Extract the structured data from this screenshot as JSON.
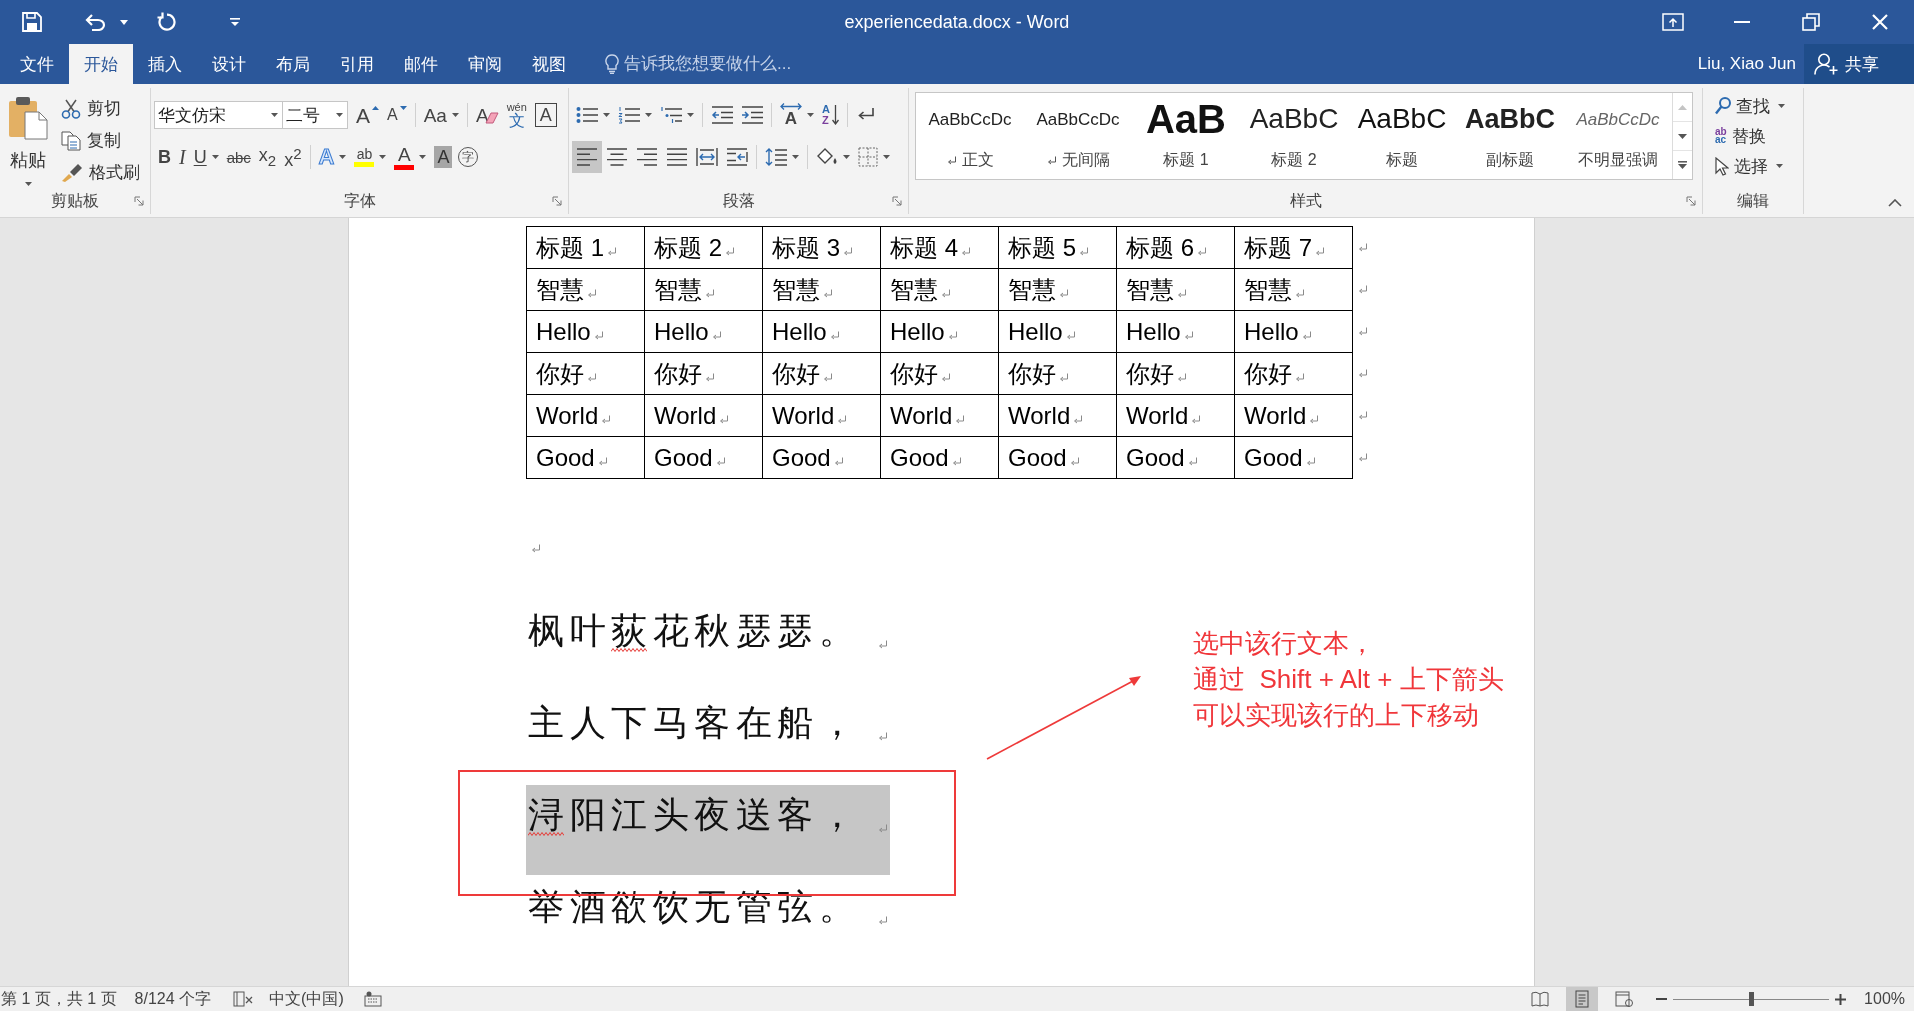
{
  "window": {
    "title": "experiencedata.docx - Word"
  },
  "tabs": [
    {
      "label": "文件",
      "selected": false
    },
    {
      "label": "开始",
      "selected": true
    },
    {
      "label": "插入",
      "selected": false
    },
    {
      "label": "设计",
      "selected": false
    },
    {
      "label": "布局",
      "selected": false
    },
    {
      "label": "引用",
      "selected": false
    },
    {
      "label": "邮件",
      "selected": false
    },
    {
      "label": "审阅",
      "selected": false
    },
    {
      "label": "视图",
      "selected": false
    }
  ],
  "tell_me": {
    "placeholder": "告诉我您想要做什么..."
  },
  "account": {
    "user": "Liu, Xiao Jun",
    "share_label": "共享"
  },
  "ribbon": {
    "clipboard": {
      "label": "剪贴板",
      "paste_label": "粘贴",
      "actions": [
        {
          "kind": "cut",
          "label": "剪切"
        },
        {
          "kind": "copy",
          "label": "复制"
        },
        {
          "kind": "format_painter",
          "label": "格式刷"
        }
      ]
    },
    "font": {
      "label": "字体",
      "font_name": "华文仿宋",
      "font_size": "二号",
      "row_1": [
        {
          "kind": "grow",
          "glyph": "A",
          "dropdown": false
        },
        {
          "kind": "shrink",
          "glyph": "A",
          "dropdown": false
        },
        {
          "kind": "change_case",
          "glyph": "Aa",
          "dropdown": true
        },
        {
          "kind": "clear",
          "glyph": "A",
          "dropdown": false
        },
        {
          "kind": "phonetic",
          "glyph": "文",
          "ruby": "wén",
          "dropdown": false
        },
        {
          "kind": "border",
          "glyph": "A",
          "dropdown": false
        }
      ],
      "row_2": [
        {
          "kind": "bold",
          "glyph": "B",
          "dropdown": false
        },
        {
          "kind": "italic",
          "glyph": "I",
          "dropdown": false
        },
        {
          "kind": "underline",
          "glyph": "U",
          "dropdown": true
        },
        {
          "kind": "strike",
          "glyph": "abc",
          "dropdown": false
        },
        {
          "kind": "subscript",
          "glyph": "x$_{2}$",
          "dropdown": false
        },
        {
          "kind": "superscript",
          "glyph": "x$^{2}$",
          "dropdown": false
        },
        {
          "kind": "effects",
          "glyph": "A",
          "dropdown": true
        },
        {
          "kind": "highlight",
          "glyph": "ab",
          "color": "#ffff00",
          "dropdown": true
        },
        {
          "kind": "font_color",
          "glyph": "A",
          "color": "#ff0000",
          "dropdown": true
        },
        {
          "kind": "shading",
          "glyph": "A",
          "dropdown": false
        },
        {
          "kind": "enclose",
          "glyph": "字",
          "dropdown": false
        }
      ]
    },
    "paragraph": {
      "label": "段落",
      "row_1": [
        {
          "kind": "bullets",
          "dropdown": true
        },
        {
          "kind": "numbering",
          "dropdown": true
        },
        {
          "kind": "multilevel",
          "dropdown": true
        },
        {
          "kind": "outdent",
          "dropdown": false
        },
        {
          "kind": "indent",
          "dropdown": false
        },
        {
          "kind": "asian_layout",
          "glyph": "A",
          "dropdown": true
        },
        {
          "kind": "sort",
          "glyph": "A",
          "glyph_2": "Z",
          "dropdown": false
        },
        {
          "kind": "show_marks",
          "dropdown": false
        }
      ],
      "alignment": [
        {
          "kind": "left",
          "selected": true
        },
        {
          "kind": "center",
          "selected": false
        },
        {
          "kind": "right",
          "selected": false
        },
        {
          "kind": "justify",
          "selected": false
        },
        {
          "kind": "distributed",
          "selected": false
        },
        {
          "kind": "character_distributed",
          "selected": false
        }
      ],
      "row_2": [
        {
          "kind": "line_spacing",
          "dropdown": true
        },
        {
          "kind": "shading",
          "dropdown": true
        },
        {
          "kind": "borders",
          "dropdown": true
        }
      ]
    },
    "styles": {
      "label": "样式",
      "items": [
        {
          "kind": "normal",
          "preview": "AaBbCcDc",
          "name": "正文",
          "paragraph_mark": true
        },
        {
          "kind": "no_spacing",
          "preview": "AaBbCcDc",
          "name": "无间隔",
          "paragraph_mark": true
        },
        {
          "kind": "heading_1",
          "preview": "AaB",
          "name": "标题 1",
          "paragraph_mark": false
        },
        {
          "kind": "heading_2",
          "preview": "AaBbC",
          "name": "标题 2",
          "paragraph_mark": false
        },
        {
          "kind": "title",
          "preview": "AaBbC",
          "name": "标题",
          "paragraph_mark": false
        },
        {
          "kind": "subtitle",
          "preview": "AaBbC",
          "name": "副标题",
          "paragraph_mark": false
        },
        {
          "kind": "subtle_emphasis",
          "preview": "AaBbCcDc",
          "name": "不明显强调",
          "paragraph_mark": false
        }
      ]
    },
    "editing": {
      "label": "编辑",
      "actions": [
        {
          "kind": "find",
          "label": "查找",
          "dropdown": true
        },
        {
          "kind": "replace",
          "label": "替换",
          "icon_glyphs": [
            "ab",
            "ac"
          ],
          "dropdown": false
        },
        {
          "kind": "select",
          "label": "选择",
          "dropdown": true
        }
      ]
    }
  },
  "document": {
    "formatting_marks": true,
    "table": {
      "rows": [
        [
          "标题 1",
          "标题 2",
          "标题 3",
          "标题 4",
          "标题 5",
          "标题 6",
          "标题 7"
        ],
        [
          "智慧",
          "智慧",
          "智慧",
          "智慧",
          "智慧",
          "智慧",
          "智慧"
        ],
        [
          "Hello",
          "Hello",
          "Hello",
          "Hello",
          "Hello",
          "Hello",
          "Hello"
        ],
        [
          "你好",
          "你好",
          "你好",
          "你好",
          "你好",
          "你好",
          "你好"
        ],
        [
          "World",
          "World",
          "World",
          "World",
          "World",
          "World",
          "World"
        ],
        [
          "Good",
          "Good",
          "Good",
          "Good",
          "Good",
          "Good",
          "Good"
        ]
      ]
    },
    "lines": [
      {
        "selected": false,
        "segments": [
          {
            "text": "枫叶",
            "flagged": false
          },
          {
            "text": "荻",
            "flagged": true
          },
          {
            "text": "花秋瑟瑟。",
            "flagged": false
          }
        ]
      },
      {
        "selected": false,
        "segments": [
          {
            "text": "主人下马客在船，",
            "flagged": false
          }
        ]
      },
      {
        "selected": true,
        "segments": [
          {
            "text": "浔",
            "flagged": true
          },
          {
            "text": "阳江头夜送客，",
            "flagged": false
          }
        ]
      },
      {
        "selected": false,
        "segments": [
          {
            "text": "举酒欲饮无管弦。",
            "flagged": false
          }
        ]
      }
    ]
  },
  "annotation": {
    "note_lines": [
      "选中该行文本，",
      "通过  Shift + Alt + 上下箭头",
      "可以实现该行的上下移动"
    ]
  },
  "status_bar": {
    "page": "第 1 页，共 1 页",
    "words": "8/124 个字",
    "language": "中文(中国)",
    "views": [
      {
        "kind": "read",
        "selected": false
      },
      {
        "kind": "print",
        "selected": true
      },
      {
        "kind": "web",
        "selected": false
      }
    ],
    "zoom": {
      "level": 0.5,
      "reading": "100%"
    }
  }
}
